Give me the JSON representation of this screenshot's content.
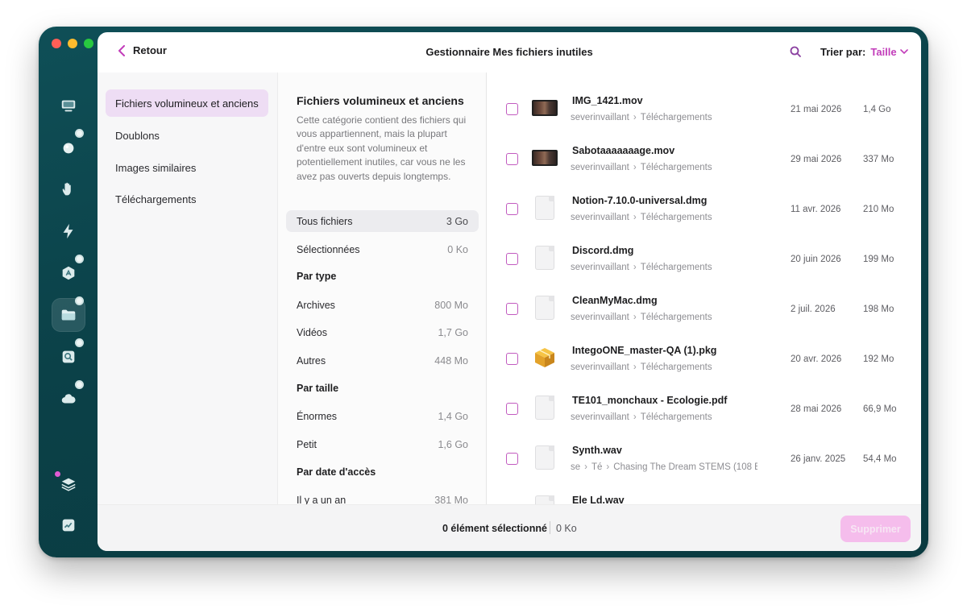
{
  "topbar": {
    "back_label": "Retour",
    "title": "Gestionnaire Mes fichiers inutiles",
    "sort_label": "Trier par:",
    "sort_value": "Taille"
  },
  "categories": [
    {
      "label": "Fichiers volumineux et anciens",
      "active": true
    },
    {
      "label": "Doublons"
    },
    {
      "label": "Images similaires"
    },
    {
      "label": "Téléchargements"
    }
  ],
  "details": {
    "title": "Fichiers volumineux et anciens",
    "description": "Cette catégorie contient des fichiers qui vous appartiennent, mais la plupart d'entre eux sont volumineux et potentiellement inutiles, car vous ne les avez pas ouverts depuis longtemps.",
    "all_files": {
      "label": "Tous fichiers",
      "value": "3 Go"
    },
    "selected": {
      "label": "Sélectionnées",
      "value": "0 Ko"
    },
    "by_type": {
      "heading": "Par type",
      "rows": [
        {
          "label": "Archives",
          "value": "800 Mo"
        },
        {
          "label": "Vidéos",
          "value": "1,7 Go"
        },
        {
          "label": "Autres",
          "value": "448 Mo"
        }
      ]
    },
    "by_size": {
      "heading": "Par taille",
      "rows": [
        {
          "label": "Énormes",
          "value": "1,4 Go"
        },
        {
          "label": "Petit",
          "value": "1,6 Go"
        }
      ]
    },
    "by_access": {
      "heading": "Par date d'accès",
      "rows": [
        {
          "label": "Il y a un an",
          "value": "381 Mo"
        }
      ]
    }
  },
  "files": [
    {
      "name": "IMG_1421.mov",
      "user": "severinvaillant",
      "folder": "Téléchargements",
      "date": "21 mai 2026",
      "size": "1,4 Go",
      "icon": "video-thumbnail-icon"
    },
    {
      "name": "Sabotaaaaaaage.mov",
      "user": "severinvaillant",
      "folder": "Téléchargements",
      "date": "29 mai 2026",
      "size": "337 Mo",
      "icon": "video-thumbnail-icon"
    },
    {
      "name": "Notion-7.10.0-universal.dmg",
      "user": "severinvaillant",
      "folder": "Téléchargements",
      "date": "11 avr. 2026",
      "size": "210 Mo",
      "icon": "disk-image-icon"
    },
    {
      "name": "Discord.dmg",
      "user": "severinvaillant",
      "folder": "Téléchargements",
      "date": "20 juin 2026",
      "size": "199 Mo",
      "icon": "disk-image-icon"
    },
    {
      "name": "CleanMyMac.dmg",
      "user": "severinvaillant",
      "folder": "Téléchargements",
      "date": "2 juil. 2026",
      "size": "198 Mo",
      "icon": "disk-image-icon"
    },
    {
      "name": "IntegoONE_master-QA (1).pkg",
      "user": "severinvaillant",
      "folder": "Téléchargements",
      "date": "20 avr. 2026",
      "size": "192 Mo",
      "icon": "package-icon"
    },
    {
      "name": "TE101_monchaux - Ecologie.pdf",
      "user": "severinvaillant",
      "folder": "Téléchargements",
      "date": "28 mai 2026",
      "size": "66,9 Mo",
      "icon": "pdf-document-icon"
    },
    {
      "name": "Synth.wav",
      "user": "se",
      "folder": "Té",
      "extra": "Chasing The Dream STEMS (108 B",
      "date": "26 janv. 2025",
      "size": "54,4 Mo",
      "icon": "audio-file-icon"
    },
    {
      "name": "Ele Ld.wav",
      "user": "",
      "folder": "",
      "date": "",
      "size": "",
      "icon": "audio-file-icon"
    }
  ],
  "bottom": {
    "selection_text": "0 élément sélectionné",
    "selection_size": "0 Ko",
    "delete_label": "Supprimer"
  }
}
